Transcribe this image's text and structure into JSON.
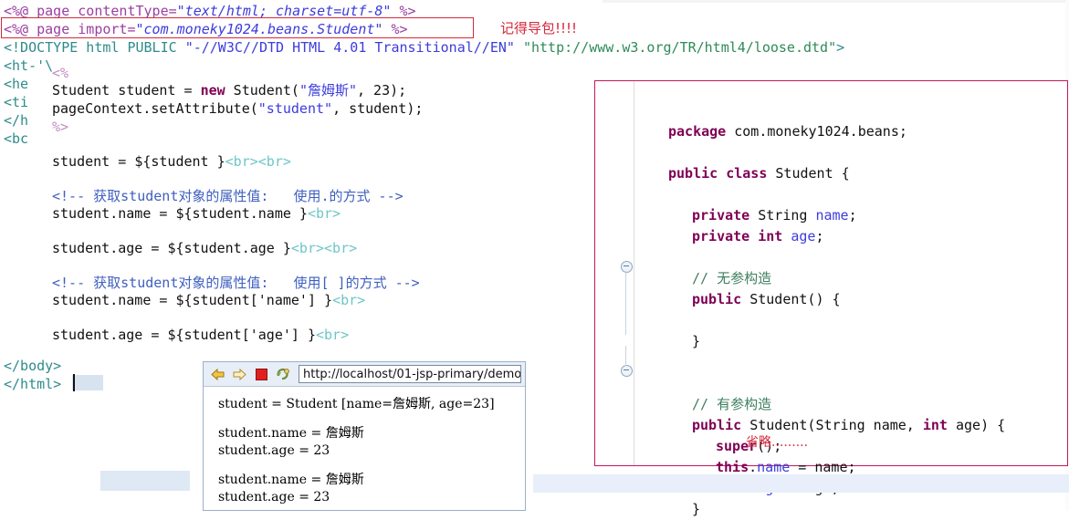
{
  "jsp": {
    "directives": [
      {
        "pre": "<%@ page contentType=",
        "str": "\"text/html; charset=utf-8\"",
        "post": " %>"
      },
      {
        "pre": "<%@ page import=",
        "str": "\"com.moneky1024.beans.Student\"",
        "post": " %>"
      }
    ],
    "doctype_pre": "<!DOCTYPE html PUBLIC ",
    "doctype_s1": "\"-//W3C//DTD HTML 4.01 Transitional//EN\"",
    "doctype_s2": " \"http://www.w3.org/TR/html4/loose.dtd\"",
    "doctype_end": ">",
    "clipped_tags": [
      "<ht-'\\",
      "<he",
      "<ti",
      "</h",
      "<bc"
    ],
    "scriptlet_open": "<%",
    "scriptlet_close": "%>",
    "line_new_student_a": "Student student = ",
    "line_new_student_kw": "new",
    "line_new_student_b": " Student(",
    "line_new_student_name": "\"詹姆斯\"",
    "line_new_student_c": ", 23);",
    "line_setattr_a": "pageContext.setAttribute(",
    "line_setattr_str": "\"student\"",
    "line_setattr_b": ", student);",
    "el_student_label": "student = ",
    "el_student_expr": "${student }",
    "el_student_br": "<br><br>",
    "comment_dot": "<!-- 获取student对象的属性值:   使用.的方式 -->",
    "name_dot_label": "student.name = ",
    "name_dot_expr": "${student.name }",
    "name_dot_br": "<br>",
    "age_dot_label": "student.age = ",
    "age_dot_expr": "${student.age }",
    "age_dot_br": "<br><br>",
    "comment_bracket": "<!-- 获取student对象的属性值:   使用[ ]的方式 -->",
    "name_br_label": "student.name = ",
    "name_br_expr": "${student['name'] }",
    "name_br_br": "<br>",
    "age_br_label": "student.age = ",
    "age_br_expr": "${student['age'] }",
    "age_br_br": "<br>",
    "close_body": "</body>",
    "close_html": "</html>"
  },
  "annotations": {
    "remember_import": "记得导包!!!!",
    "omit": "省略.........",
    "import_box_color": "#d42a3c",
    "java_panel_border_color": "#c2185b"
  },
  "browser": {
    "url": "http://localhost/01-jsp-primary/demo02.jsp",
    "icons": {
      "back": "back-arrow-icon",
      "forward": "forward-arrow-icon",
      "stop": "stop-icon",
      "refresh": "refresh-icon"
    },
    "output": [
      "student = Student [name=詹姆斯, age=23]",
      "",
      "student.name = 詹姆斯",
      "student.age = 23",
      "",
      "student.name = 詹姆斯",
      "student.age = 23"
    ]
  },
  "java": {
    "package_kw": "package",
    "package_name": " com.moneky1024.beans;",
    "class_kw1": "public class",
    "class_name": " Student {",
    "field1_kw": "private",
    "field1_type": " String ",
    "field1_name": "name",
    "field1_end": ";",
    "field2_kw": "private int ",
    "field2_name": "age",
    "field2_end": ";",
    "comment_noarg": "// 无参构造",
    "ctor_noarg_kw": "public",
    "ctor_noarg_sig": " Student() {",
    "ctor_noarg_close": "}",
    "comment_arg": "// 有参构造",
    "ctor_arg_kw": "public",
    "ctor_arg_a": " Student(String name, ",
    "ctor_arg_int": "int",
    "ctor_arg_b": " age) {",
    "super_kw": "super",
    "super_rest": "();",
    "this1_kw": "this",
    "this1_dot": ".",
    "this1_field": "name",
    "this1_rest": " = name;",
    "this2_kw": "this",
    "this2_dot": ".",
    "this2_field": "age",
    "this2_rest": " = age;",
    "ctor_arg_close": "}"
  }
}
